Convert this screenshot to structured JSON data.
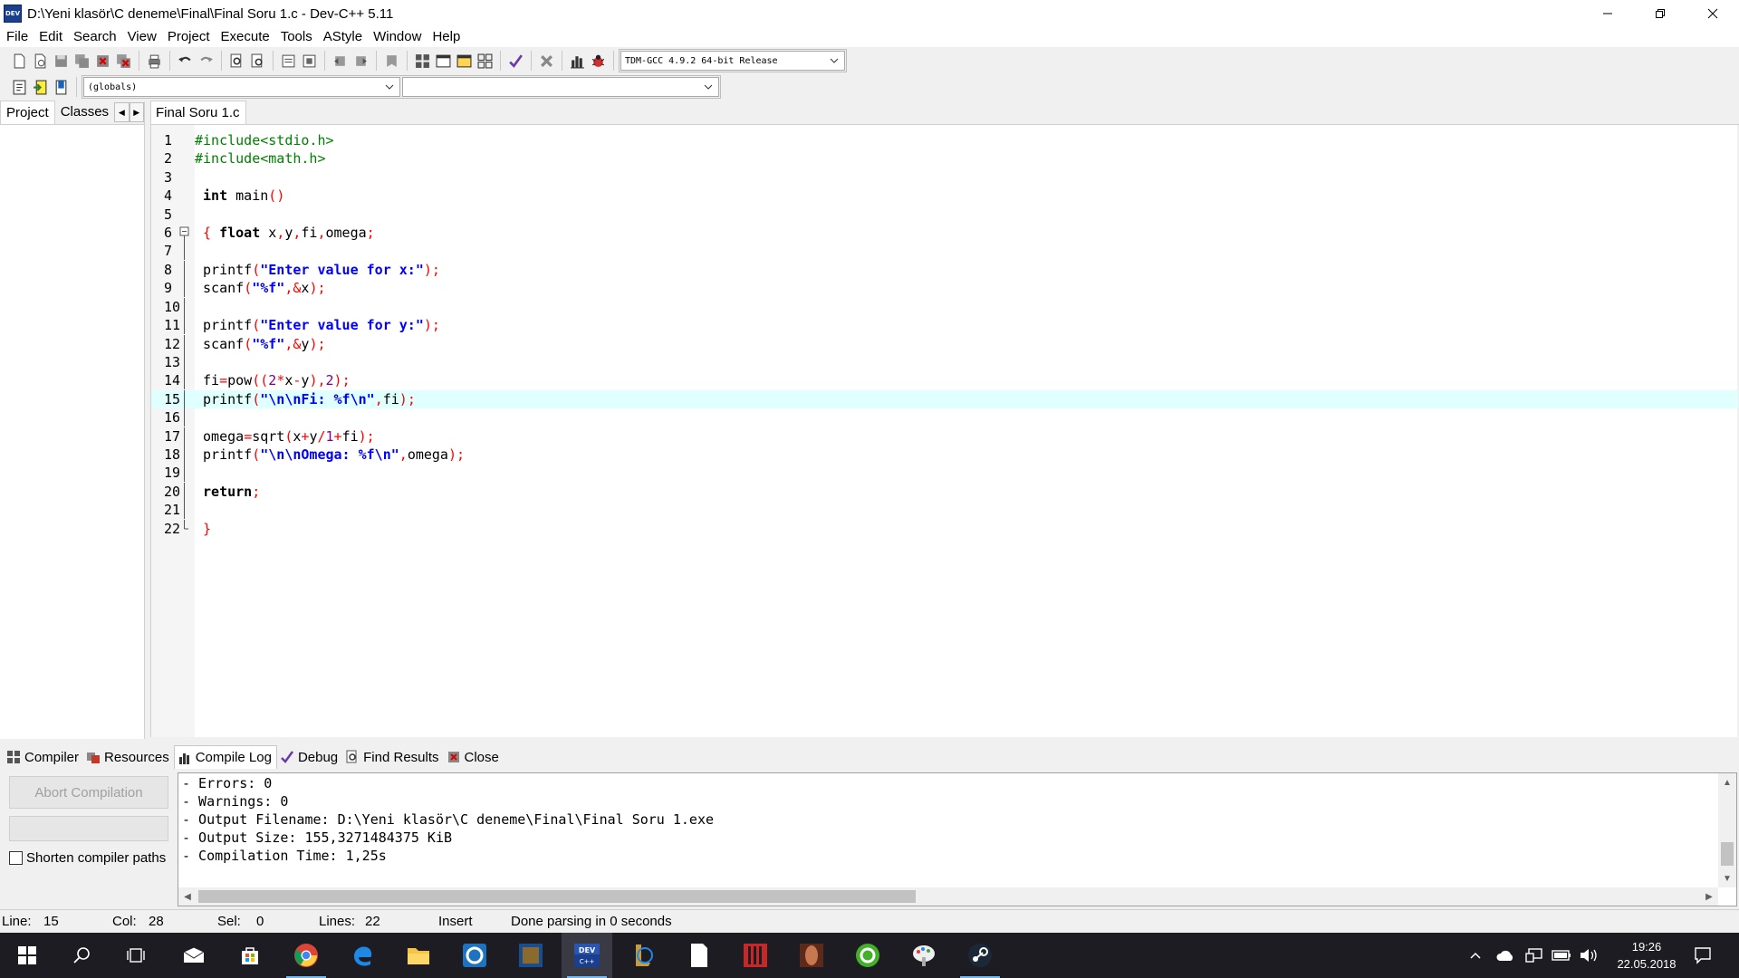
{
  "window": {
    "title": "D:\\Yeni klasör\\C deneme\\Final\\Final Soru 1.c - Dev-C++ 5.11",
    "app_icon_text": "DEV"
  },
  "menu": [
    "File",
    "Edit",
    "Search",
    "View",
    "Project",
    "Execute",
    "Tools",
    "AStyle",
    "Window",
    "Help"
  ],
  "toolbar": {
    "compiler_select": "TDM-GCC 4.9.2 64-bit Release",
    "scope_select": "(globals)",
    "function_select": ""
  },
  "left_panel": {
    "tabs": [
      "Project",
      "Classes"
    ]
  },
  "editor": {
    "tab": "Final Soru 1.c",
    "highlight_line": 15,
    "fold_line": 6,
    "lines": [
      "#include<stdio.h>",
      "#include<math.h>",
      "",
      " int main()",
      "",
      " { float x,y,fi,omega;",
      "",
      " printf(\"Enter value for x:\");",
      " scanf(\"%f\",&x);",
      "",
      " printf(\"Enter value for y:\");",
      " scanf(\"%f\",&y);",
      "",
      " fi=pow((2*x-y),2);",
      " printf(\"\\n\\nFi: %f\\n\",fi);",
      "",
      " omega=sqrt(x+y/1+fi);",
      " printf(\"\\n\\nOmega: %f\\n\",omega);",
      "",
      " return;",
      "",
      " }"
    ]
  },
  "bottom_tabs": [
    "Compiler",
    "Resources",
    "Compile Log",
    "Debug",
    "Find Results",
    "Close"
  ],
  "bottom": {
    "abort_label": "Abort Compilation",
    "shorten_label": "Shorten compiler paths",
    "shorten_checked": false,
    "progress": 0,
    "log": [
      "- Errors: 0",
      "- Warnings: 0",
      "- Output Filename: D:\\Yeni klasör\\C deneme\\Final\\Final Soru 1.exe",
      "- Output Size: 155,3271484375 KiB",
      "- Compilation Time: 1,25s"
    ]
  },
  "status": {
    "line_label": "Line:",
    "line_value": "15",
    "col_label": "Col:",
    "col_value": "28",
    "sel_label": "Sel:",
    "sel_value": "0",
    "lines_label": "Lines:",
    "lines_value": "22",
    "mode": "Insert",
    "message": "Done parsing in 0 seconds"
  },
  "taskbar": {
    "time": "19:26",
    "date": "22.05.2018",
    "active_app": "devcpp"
  },
  "colors": {
    "highlight": "#e0ffff",
    "preprocessor": "#008000",
    "string": "#0000ff",
    "symbol": "#ff0000",
    "number": "#800080",
    "taskbar": "#1c1c22"
  }
}
